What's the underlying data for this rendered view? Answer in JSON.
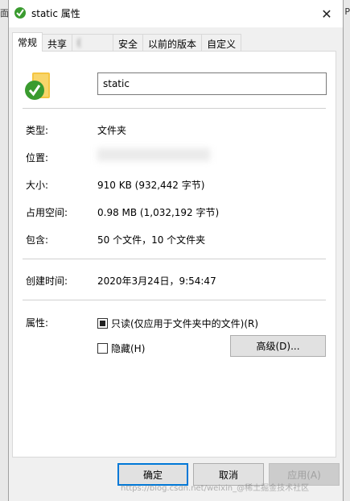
{
  "background": {
    "left_text": "面",
    "right_text": "P"
  },
  "window": {
    "title": "static 属性",
    "close_glyph": "✕"
  },
  "tabs": [
    {
      "label": "常规",
      "active": true
    },
    {
      "label": "共享"
    },
    {
      "label": "(",
      "blurred": true
    },
    {
      "label": "安全"
    },
    {
      "label": "以前的版本"
    },
    {
      "label": "自定义"
    }
  ],
  "general": {
    "name_value": "static",
    "type_label": "类型:",
    "type_value": "文件夹",
    "location_label": "位置:",
    "size_label": "大小:",
    "size_value": "910 KB (932,442 字节)",
    "disk_size_label": "占用空间:",
    "disk_size_value": "0.98 MB (1,032,192 字节)",
    "contains_label": "包含:",
    "contains_value": "50 个文件，10 个文件夹",
    "created_label": "创建时间:",
    "created_value": "2020年3月24日，9:54:47",
    "attributes_label": "属性:",
    "readonly_label": "只读(仅应用于文件夹中的文件)(R)",
    "hidden_label": "隐藏(H)",
    "advanced_button": "高级(D)..."
  },
  "footer": {
    "ok": "确定",
    "cancel": "取消",
    "apply": "应用(A)"
  },
  "watermark": "https://blog.csdn.net/weixin_@稀土掘金技术社区",
  "colors": {
    "accent": "#0078d7",
    "folder": "#f5c542",
    "check": "#3a9b2f"
  }
}
